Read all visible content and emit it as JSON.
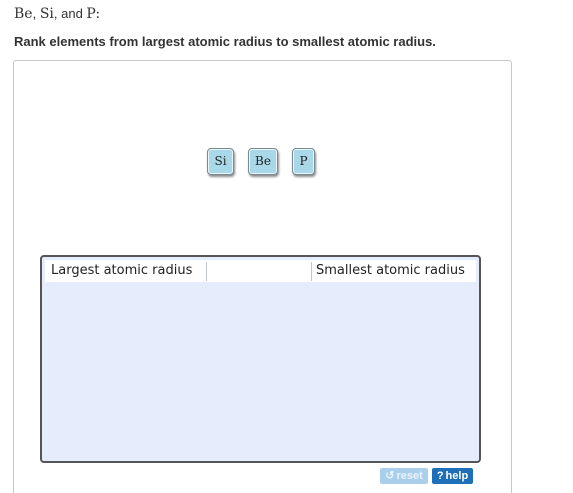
{
  "header": {
    "elements": [
      "Be",
      "Si",
      "P"
    ],
    "separator_1": ", ",
    "separator_2": ", and ",
    "suffix": ":"
  },
  "instruction": "Rank elements from largest atomic radius to smallest atomic radius.",
  "tiles": [
    {
      "label": "Si"
    },
    {
      "label": "Be"
    },
    {
      "label": "P"
    }
  ],
  "ranking": {
    "left_label": "Largest atomic radius",
    "right_label": "Smallest atomic radius"
  },
  "buttons": {
    "reset_label": "reset",
    "reset_icon": "reset-icon",
    "help_label": "help",
    "help_icon": "question-icon"
  },
  "colors": {
    "tile_fill": "#a9d9e9",
    "ranking_fill": "#e5ecfb",
    "help_button": "#1f6fb8",
    "reset_button": "#a9cfec"
  }
}
